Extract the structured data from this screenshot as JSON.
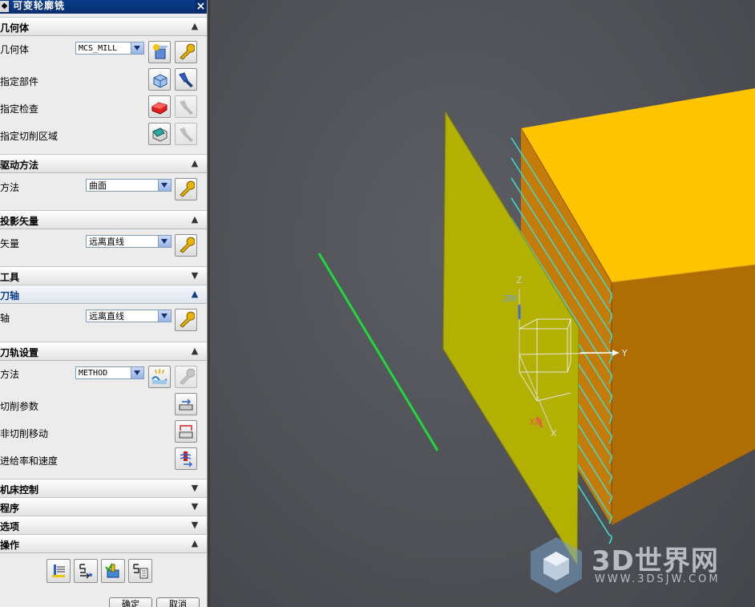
{
  "window": {
    "title": "可变轮廓铣",
    "close_label": "×"
  },
  "sections": {
    "geometry": {
      "header": "几何体",
      "geometry_label": "几何体",
      "geometry_value": "MCS_MILL",
      "specify_part": "指定部件",
      "specify_check": "指定检查",
      "specify_cut_area": "指定切削区域"
    },
    "drive": {
      "header": "驱动方法",
      "method_label": "方法",
      "method_value": "曲面"
    },
    "projection": {
      "header": "投影矢量",
      "vector_label": "矢量",
      "vector_value": "远离直线"
    },
    "tool": {
      "header": "工具"
    },
    "tool_axis": {
      "header": "刀轴",
      "axis_label": "轴",
      "axis_value": "远离直线"
    },
    "path_settings": {
      "header": "刀轨设置",
      "method_label": "方法",
      "method_value": "METHOD",
      "cut_params": "切削参数",
      "non_cut_moves": "非切削移动",
      "feeds_speeds": "进给率和速度"
    },
    "machine_control": {
      "header": "机床控制"
    },
    "program": {
      "header": "程序"
    },
    "options": {
      "header": "选项"
    },
    "actions": {
      "header": "操作"
    }
  },
  "dialog_buttons": {
    "ok": "确定",
    "cancel": "取消"
  },
  "viewport": {
    "axis_labels": {
      "z": "Z",
      "zm": "ZM",
      "y": "Y",
      "xm": "XM",
      "x": "X"
    }
  },
  "watermark": {
    "brand": "3D世界网",
    "url": "WWW.3DSJW.COM"
  },
  "colors": {
    "title_bar": "#0b3c8c",
    "block_top": "#ffc400",
    "block_side": "#b06d05",
    "surface": "#b2b000",
    "toolpath": "#3fd9d0",
    "line": "#21d83a"
  }
}
